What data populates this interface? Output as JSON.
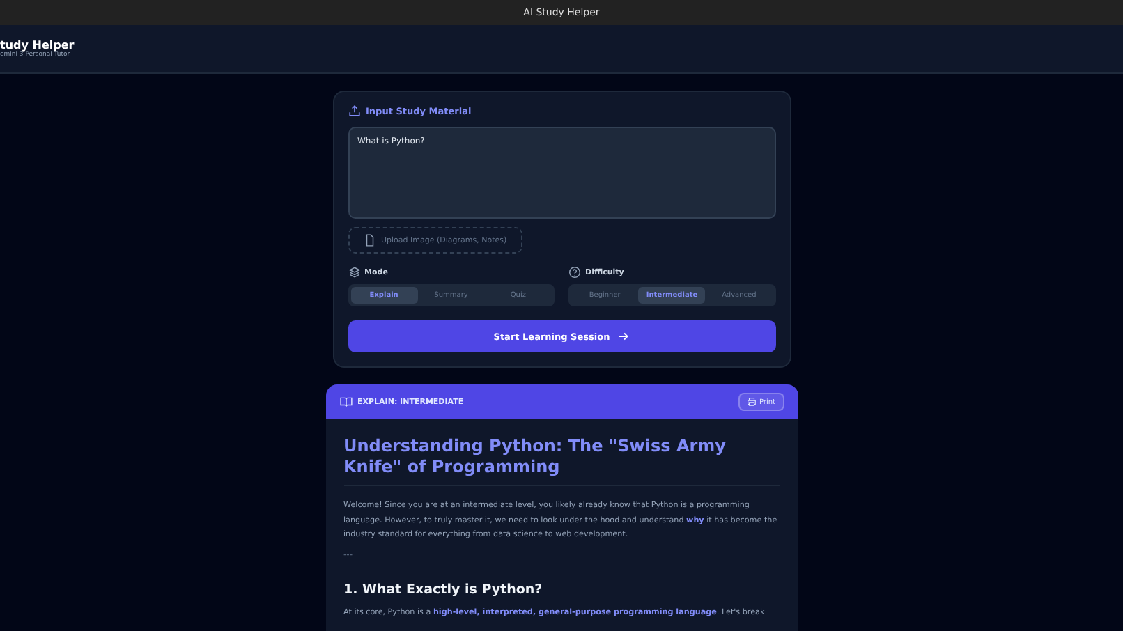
{
  "window": {
    "title": "AI Study Helper"
  },
  "app_header": {
    "title": "tudy Helper",
    "subtitle": "emini 3 Personal Tutor"
  },
  "input_panel": {
    "heading": "Input Study Material",
    "textarea": {
      "value": "What is Python?"
    },
    "upload_button": "Upload Image (Diagrams, Notes)",
    "mode": {
      "label": "Mode",
      "options": [
        {
          "label": "Explain",
          "selected": true
        },
        {
          "label": "Summary",
          "selected": false
        },
        {
          "label": "Quiz",
          "selected": false
        }
      ]
    },
    "difficulty": {
      "label": "Difficulty",
      "options": [
        {
          "label": "Beginner",
          "selected": false
        },
        {
          "label": "Intermediate",
          "selected": true
        },
        {
          "label": "Advanced",
          "selected": false
        }
      ]
    },
    "submit_button": "Start Learning Session"
  },
  "result_panel": {
    "header": "EXPLAIN: INTERMEDIATE",
    "print_button": "Print",
    "title": "Understanding Python: The \"Swiss Army Knife\" of Programming",
    "intro": "Welcome! Since you are at an intermediate level, you likely already know that Python is a programming language. However, to truly master it, we need to look under the hood and understand **why** it has become the industry standard for everything from data science to web development.",
    "separator": "---",
    "section_heading": "1. What Exactly is Python?",
    "section_text": "At its core, Python is a **high-level, interpreted, general-purpose programming language**. Let's break"
  }
}
